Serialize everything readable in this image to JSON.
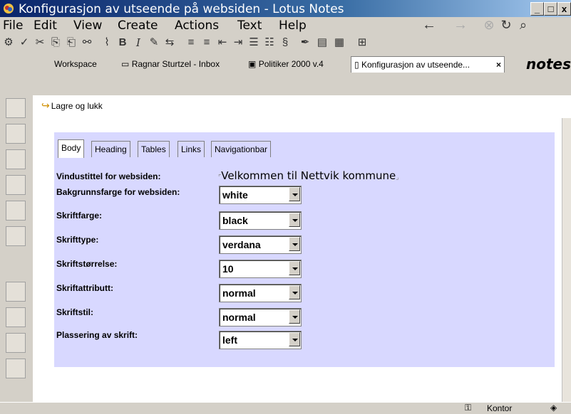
{
  "window": {
    "title": "Konfigurasjon av utseende på websiden - Lotus Notes"
  },
  "menu": [
    "File",
    "Edit",
    "View",
    "Create",
    "Actions",
    "Text",
    "Help"
  ],
  "window_tabs": [
    "Workspace",
    "Ragnar Sturtzel - Inbox",
    "Politiker 2000 v.4",
    "Konfigurasjon av utseende..."
  ],
  "brand": "notes",
  "action": {
    "save_close": "Lagre og lukk"
  },
  "form_tabs": [
    "Body",
    "Heading",
    "Tables",
    "Links",
    "Navigationbar"
  ],
  "fields": {
    "window_title_label": "Vindustittel for websiden:",
    "window_title_value": "Velkommen til Nettvik kommune",
    "bgcolor_label": "Bakgrunnsfarge for websiden:",
    "bgcolor_value": "white",
    "fontcolor_label": "Skriftfarge:",
    "fontcolor_value": "black",
    "fonttype_label": "Skrifttype:",
    "fonttype_value": "verdana",
    "fontsize_label": "Skriftstørrelse:",
    "fontsize_value": "10",
    "fontattr_label": "Skriftattributt:",
    "fontattr_value": "normal",
    "fontstyle_label": "Skriftstil:",
    "fontstyle_value": "normal",
    "align_label": "Plassering av skrift:",
    "align_value": "left"
  },
  "status": {
    "location": "Kontor"
  },
  "colors": {
    "titlebar": "#0a246a",
    "panel": "#d8d8ff"
  }
}
